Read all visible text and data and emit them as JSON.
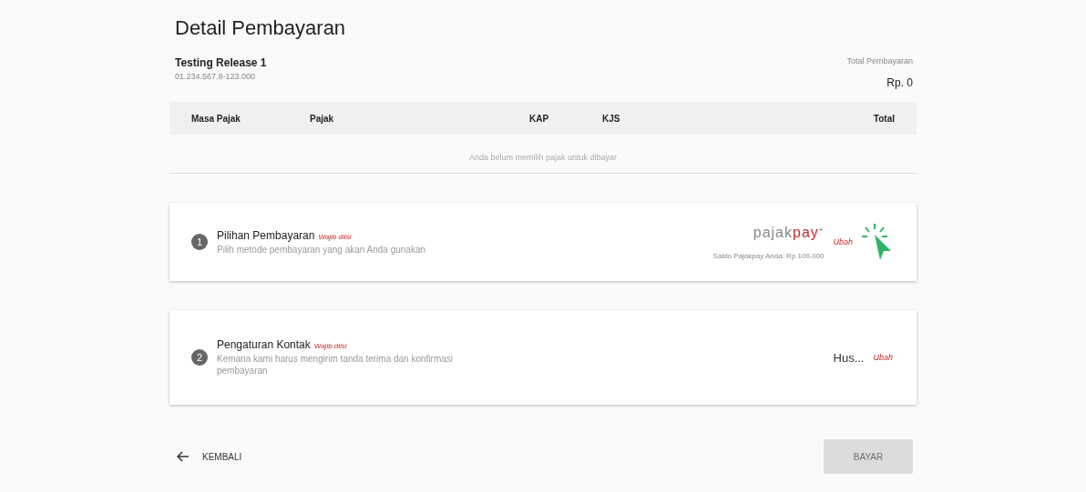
{
  "title": "Detail Pembayaran",
  "taxpayer": {
    "name": "Testing Release 1",
    "id": "01.234.567.8-123.000"
  },
  "total": {
    "label": "Total Pembayaran",
    "amount": "Rp. 0"
  },
  "table": {
    "columns": [
      "Masa Pajak",
      "Pajak",
      "KAP",
      "KJS",
      "Total"
    ],
    "empty": "Anda belum memilih pajak untuk dibayar"
  },
  "steps": [
    {
      "number": "1",
      "title": "Pilihan Pembayaran",
      "required": "Wajib diisi",
      "description": "Pilih metode pembayaran yang akan Anda gunakan",
      "kind": "payment",
      "logo_left": "pajak",
      "logo_right": "pay",
      "logo_mark": "+",
      "detail": "Saldo Pajakpay Anda: Rp 100.000",
      "action": "Ubah"
    },
    {
      "number": "2",
      "title": "Pengaturan Kontak",
      "required": "Wajib diisi",
      "description": "Kemana kami harus mengirim tanda terima dan konfirmasi pembayaran",
      "kind": "contact",
      "value": "Hus...",
      "action": "Ubah"
    }
  ],
  "back": {
    "label": "KEMBALI"
  },
  "pay_button": {
    "label": "BAYAR",
    "disabled": true
  }
}
